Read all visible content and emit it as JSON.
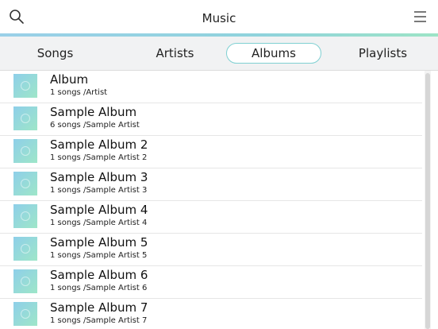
{
  "header": {
    "title": "Music",
    "left_icon": "search-icon",
    "right_icon": "menu-icon",
    "accent": "#8fd3dc"
  },
  "tabs": [
    {
      "label": "Songs",
      "active": false
    },
    {
      "label": "Artists",
      "active": false
    },
    {
      "label": "Albums",
      "active": true
    },
    {
      "label": "Playlists",
      "active": false
    }
  ],
  "albums": [
    {
      "name": "Album",
      "meta": "1 songs /Artist"
    },
    {
      "name": "Sample Album",
      "meta": "6 songs /Sample Artist"
    },
    {
      "name": "Sample Album 2",
      "meta": "1 songs /Sample Artist 2"
    },
    {
      "name": "Sample Album 3",
      "meta": "1 songs /Sample Artist 3"
    },
    {
      "name": "Sample Album 4",
      "meta": "1 songs /Sample Artist 4"
    },
    {
      "name": "Sample Album 5",
      "meta": "1 songs /Sample Artist 5"
    },
    {
      "name": "Sample Album 6",
      "meta": "1 songs /Sample Artist 6"
    },
    {
      "name": "Sample Album 7",
      "meta": "1 songs /Sample Artist 7"
    }
  ]
}
